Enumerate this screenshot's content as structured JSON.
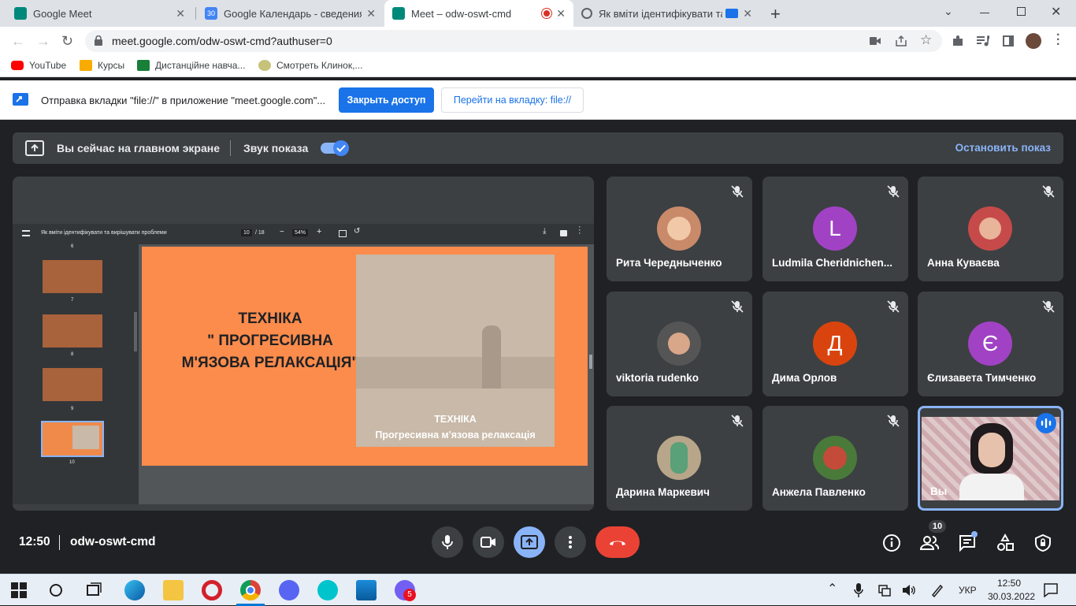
{
  "browser": {
    "tabs": [
      {
        "title": "Google Meet",
        "color": "#00897b"
      },
      {
        "title": "Google Календарь - сведения о",
        "color": "#4285f4"
      },
      {
        "title": "Meet – odw-oswt-cmd",
        "color": "#00897b"
      },
      {
        "title": "Як вміти ідентифікувати та",
        "color": "#5f6368"
      }
    ],
    "url": "meet.google.com/odw-oswt-cmd?authuser=0",
    "bookmarks": [
      "YouTube",
      "Курсы",
      "Дистанційне навча...",
      "Смотреть Клинок,..."
    ],
    "infobar": {
      "message": "Отправка вкладки \"file://\" в приложение \"meet.google.com\"...",
      "primary_button": "Закрыть доступ",
      "secondary_button": "Перейти на вкладку: file://"
    }
  },
  "meet": {
    "banner": {
      "presenting_text": "Вы сейчас на главном экране",
      "audio_label": "Звук показа",
      "audio_enabled": true,
      "stop_label": "Остановить показ"
    },
    "presentation": {
      "doc_title": "Як вміти ідентифікувати та вирішувати проблеми",
      "page_current": "10",
      "page_total": "/ 18",
      "zoom": "54%",
      "thumb_numbers": [
        "6",
        "7",
        "8",
        "9",
        "10"
      ],
      "slide_title_line1": "ТЕХНІКА",
      "slide_title_line2": "\" ПРОГРЕСИВНА",
      "slide_title_line3": "М'ЯЗОВА РЕЛАКСАЦІЯ\"",
      "image_caption_line1": "ТЕХНІКА",
      "image_caption_line2": "Прогресивна м'язова релаксація"
    },
    "participants": [
      {
        "name": "Рита Чередныченко",
        "avatar": "photo",
        "color": "#c98a6a",
        "muted": true
      },
      {
        "name": "Ludmila Cheridnichen...",
        "avatar": "L",
        "color": "#a142c4",
        "muted": true
      },
      {
        "name": "Анна Куваєва",
        "avatar": "photo",
        "color": "#c74a4a",
        "muted": true
      },
      {
        "name": "viktoria rudenko",
        "avatar": "photo",
        "color": "#555555",
        "muted": true
      },
      {
        "name": "Дима Орлов",
        "avatar": "Д",
        "color": "#d9440e",
        "muted": true
      },
      {
        "name": "Єлизавета Тимченко",
        "avatar": "Є",
        "color": "#a142c4",
        "muted": true
      },
      {
        "name": "Дарина Маркевич",
        "avatar": "photo",
        "color": "#b8a68a",
        "muted": true
      },
      {
        "name": "Анжела Павленко",
        "avatar": "photo",
        "color": "#c44a3a",
        "muted": true
      },
      {
        "name": "Вы",
        "avatar": "video",
        "color": "#d8bcc0",
        "muted": false
      }
    ],
    "footer": {
      "time": "12:50",
      "meeting_code": "odw-oswt-cmd",
      "participant_count": "10"
    }
  },
  "taskbar": {
    "language": "УКР",
    "time": "12:50",
    "date": "30.03.2022",
    "viber_badge": "5"
  }
}
